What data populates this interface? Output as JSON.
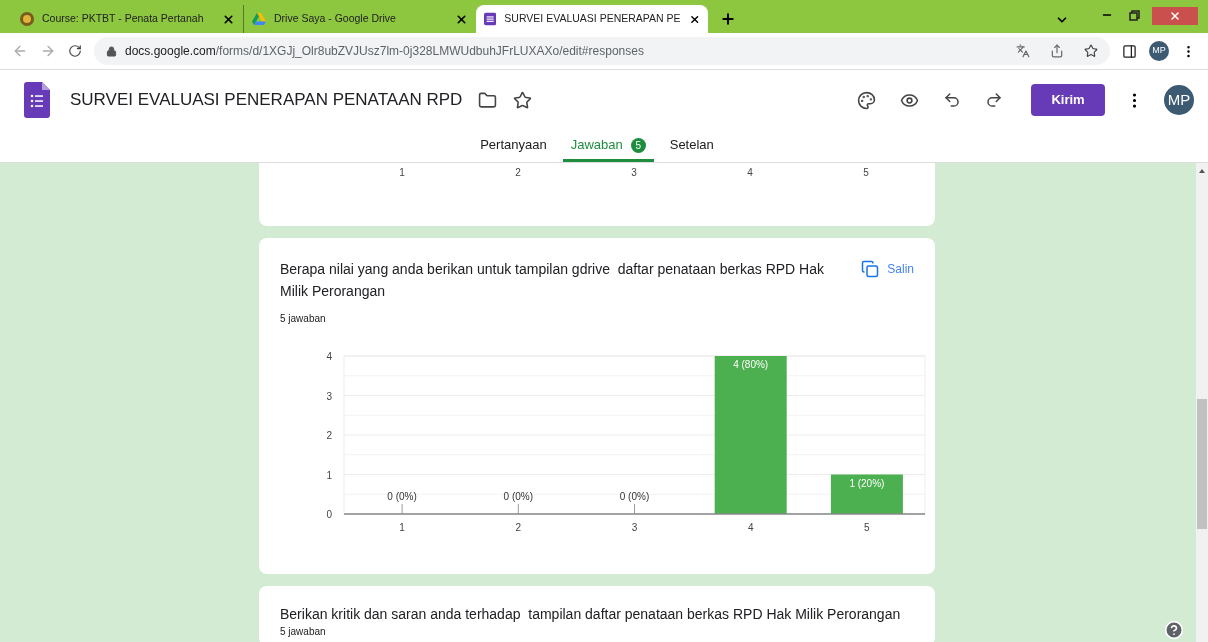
{
  "browser": {
    "tabs": [
      {
        "title": "Course: PKTBT - Penata Pertanah",
        "selected": false,
        "kind": "moodle"
      },
      {
        "title": "Drive Saya - Google Drive",
        "selected": false,
        "kind": "drive"
      },
      {
        "title": "SURVEI EVALUASI PENERAPAN PE",
        "selected": true,
        "kind": "forms"
      }
    ],
    "url_host": "docs.google.com",
    "url_path": "/forms/d/1XGJj_Olr8ubZVJUsz7lm-0j328LMWUdbuhJFrLUXAXo/edit#responses",
    "profile": "MP"
  },
  "form": {
    "title": "SURVEI EVALUASI PENERAPAN PENATAAN RPD",
    "send_button": "Kirim",
    "avatar": "MP",
    "tabs": [
      {
        "label": "Pertanyaan",
        "selected": false
      },
      {
        "label": "Jawaban",
        "selected": true,
        "badge": "5"
      },
      {
        "label": "Setelan",
        "selected": false
      }
    ]
  },
  "top_card": {
    "x_labels": [
      "1",
      "2",
      "3",
      "4",
      "5"
    ]
  },
  "question_card": {
    "question": "Berapa nilai yang anda berikan untuk tampilan gdrive  daftar penataan berkas RPD Hak Milik Perorangan",
    "copy_button": "Salin",
    "count": "5 jawaban",
    "chart_data": {
      "type": "bar",
      "categories": [
        "1",
        "2",
        "3",
        "4",
        "5"
      ],
      "series": [
        {
          "color": "#4caf50",
          "values": [
            0,
            0,
            0,
            4,
            1
          ]
        }
      ],
      "grid": true,
      "ylim": [
        0,
        4
      ],
      "yticks": [
        0,
        1,
        2,
        3,
        4
      ],
      "value_labels": [
        "0 (0%)",
        "0 (0%)",
        "0 (0%)",
        "4 (80%)",
        "1 (20%)"
      ]
    }
  },
  "next_card": {
    "question": "Berikan kritik dan saran anda terhadap  tampilan daftar penataan berkas RPD Hak Milik Perorangan",
    "count": "5 jawaban"
  }
}
